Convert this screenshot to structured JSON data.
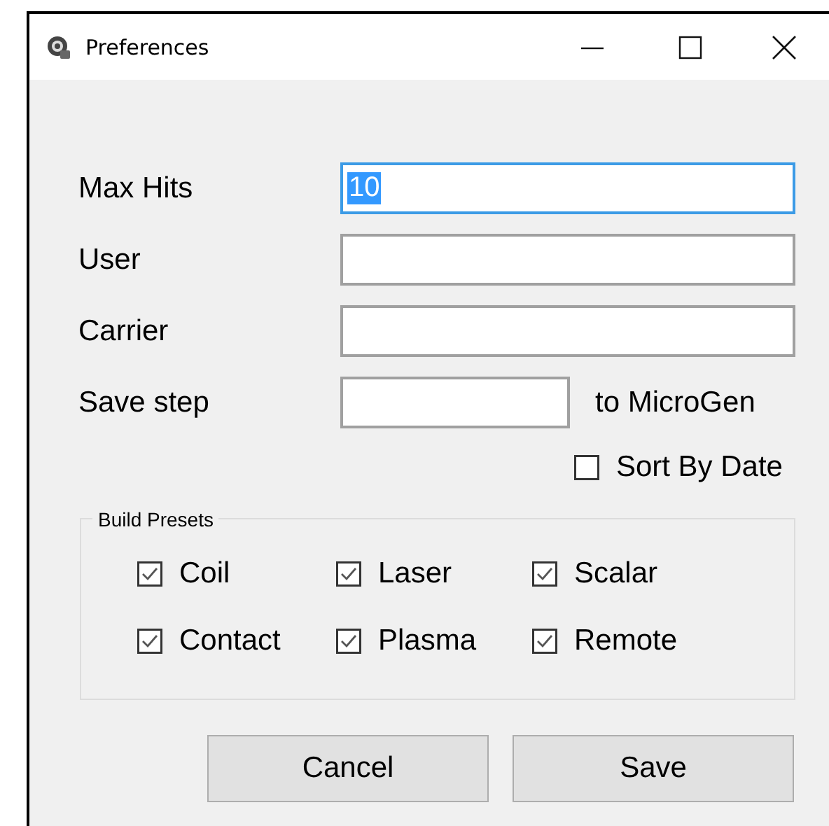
{
  "window": {
    "title": "Preferences"
  },
  "fields": [
    {
      "label": "Max Hits",
      "value": "10",
      "focused": true,
      "text_selected": true,
      "kind": "wide"
    },
    {
      "label": "User",
      "focused": false,
      "kind": "wide"
    },
    {
      "label": "Carrier",
      "focused": false,
      "kind": "wide"
    },
    {
      "label": "Save step",
      "focused": false,
      "kind": "short",
      "suffix": "to MicroGen"
    }
  ],
  "sort_by_date": {
    "label": "Sort By Date",
    "checked": false
  },
  "build_presets": {
    "title": "Build Presets",
    "options": [
      {
        "label": "Coil",
        "checked": true
      },
      {
        "label": "Laser",
        "checked": true
      },
      {
        "label": "Scalar",
        "checked": true
      },
      {
        "label": "Contact",
        "checked": true
      },
      {
        "label": "Plasma",
        "checked": true
      },
      {
        "label": "Remote",
        "checked": true
      }
    ]
  },
  "buttons": [
    "Cancel",
    "Save"
  ]
}
